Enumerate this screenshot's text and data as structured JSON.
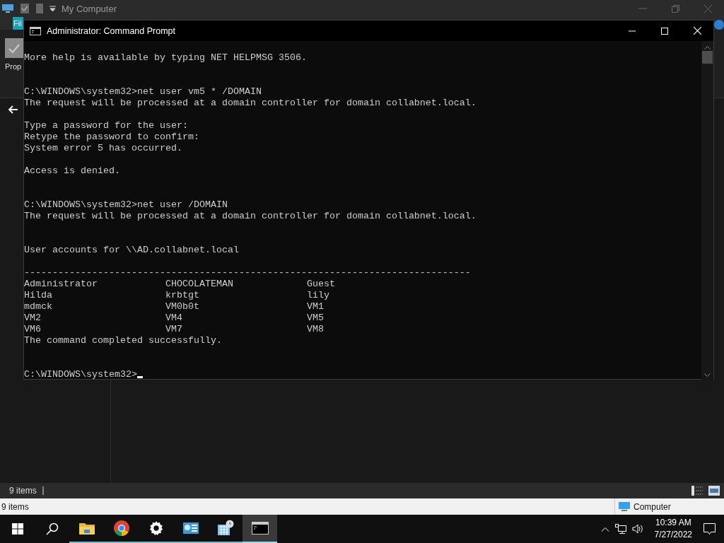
{
  "explorer": {
    "title": "My Computer",
    "ribbon_tab": "Fil",
    "ribbon_button": "Prop",
    "status": "9 items",
    "details_status": "9 items",
    "details_location": "Computer"
  },
  "console": {
    "title": "Administrator: Command Prompt",
    "blocks": [
      {
        "kind": "output",
        "lines": [
          "More help is available by typing NET HELPMSG 3506."
        ]
      },
      {
        "kind": "command",
        "lines": [
          "C:\\WINDOWS\\system32>net user vm5 * /DOMAIN",
          "The request will be processed at a domain controller for domain collabnet.local."
        ]
      },
      {
        "kind": "output",
        "lines": [
          "Type a password for the user:",
          "Retype the password to confirm:",
          "System error 5 has occurred."
        ]
      },
      {
        "kind": "output",
        "lines": [
          "Access is denied."
        ]
      },
      {
        "kind": "command",
        "lines": [
          "C:\\WINDOWS\\system32>net user /DOMAIN",
          "The request will be processed at a domain controller for domain collabnet.local."
        ]
      },
      {
        "kind": "listing",
        "lines": [
          "User accounts for \\\\AD.collabnet.local"
        ]
      },
      {
        "kind": "table",
        "rule": "-------------------------------------------------------------------------------",
        "rows": [
          [
            "Administrator",
            "CHOCOLATEMAN",
            "Guest"
          ],
          [
            "Hilda",
            "krbtgt",
            "lily"
          ],
          [
            "mdmck",
            "VM0b0t",
            "VM1"
          ],
          [
            "VM2",
            "VM4",
            "VM5"
          ],
          [
            "VM6",
            "VM7",
            "VM8"
          ]
        ]
      },
      {
        "kind": "continuation",
        "lines": [
          "The command completed successfully."
        ]
      },
      {
        "kind": "prompt",
        "lines": [
          "C:\\WINDOWS\\system32>"
        ]
      }
    ]
  },
  "taskbar": {
    "apps": [
      {
        "kind": "folder",
        "selected": false
      },
      {
        "kind": "browser",
        "selected": false
      },
      {
        "kind": "settings",
        "selected": false
      },
      {
        "kind": "panel",
        "selected": false
      },
      {
        "kind": "calendar",
        "selected": false
      },
      {
        "kind": "console",
        "selected": true
      }
    ],
    "time": "10:39 AM",
    "date": "7/27/2022"
  }
}
